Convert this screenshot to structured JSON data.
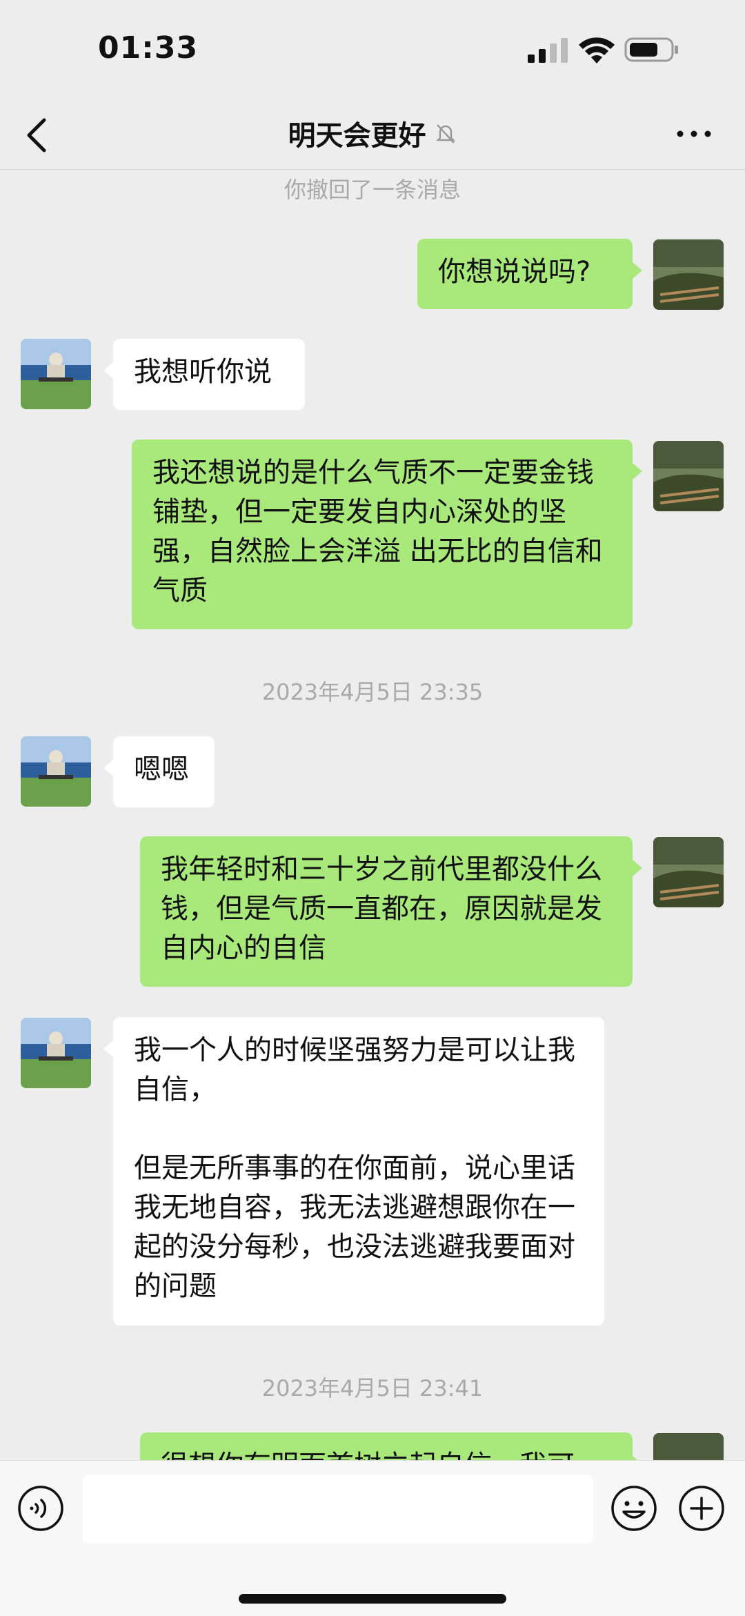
{
  "status_bar": {
    "time": "01:33"
  },
  "nav": {
    "title": "明天会更好"
  },
  "messages": {
    "system_notice": "你撤回了一条消息",
    "m1": "你想说说吗?",
    "m2": "我想听你说",
    "m3": "我还想说的是什么气质不一定要金钱铺垫，但一定要发自内心深处的坚强，自然脸上会洋溢 出无比的自信和气质",
    "stamp1": "2023年4月5日 23:35",
    "m4": "嗯嗯",
    "m5": "我年轻时和三十岁之前代里都没什么钱，但是气质一直都在，原因就是发自内心的自信",
    "m6": "我一个人的时候坚强努力是可以让我自信，\n\n但是无所事事的在你面前，说心里话我无地自容，我无法逃避想跟你在一起的没分每秒，也没法逃避我要面对的问题",
    "stamp2": "2023年4月5日 23:41",
    "m7": "很想你有明面首树立起自信，我可"
  },
  "input_bar": {
    "text": ""
  },
  "icons": {
    "back": "chevron-left-icon",
    "mute": "bell-slash-icon",
    "more": "more-dots-icon",
    "voice": "voice-icon",
    "emoji": "emoji-icon",
    "plus": "plus-icon"
  }
}
